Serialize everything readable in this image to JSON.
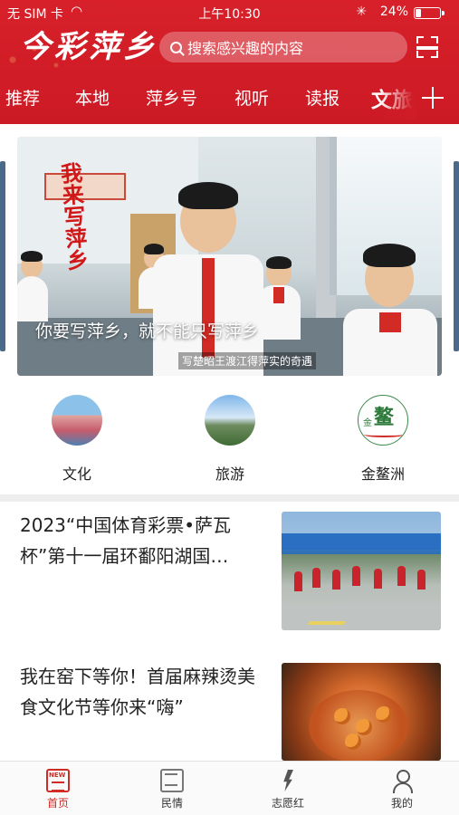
{
  "status_bar": {
    "carrier": "无 SIM 卡",
    "time": "上午10:30",
    "battery": "24%",
    "battery_level": 0.24
  },
  "header": {
    "logo_text": "今彩萍乡",
    "search_placeholder": "搜索感兴趣的内容"
  },
  "tabs": [
    {
      "label": "推荐"
    },
    {
      "label": "本地"
    },
    {
      "label": "萍乡号"
    },
    {
      "label": "视听"
    },
    {
      "label": "读报"
    },
    {
      "label": "文旅",
      "active": true
    }
  ],
  "banner": {
    "vertical_text": "我来写萍乡",
    "caption": "你要写萍乡，就不能只写萍乡",
    "subtitle": "写楚昭王渡江得萍实的奇遇"
  },
  "quick_links": [
    {
      "label": "文化",
      "icon": "culture-icon"
    },
    {
      "label": "旅游",
      "icon": "travel-icon"
    },
    {
      "label": "金鳌洲",
      "icon": "jinaozhou-icon",
      "logo_main": "鳌",
      "logo_side": "金"
    }
  ],
  "news": [
    {
      "title": "2023“中国体育彩票•萨瓦杯”第十一届环鄱阳湖国…",
      "image": "cycling-race-image"
    },
    {
      "title": "我在窑下等你！首届麻辣烫美食文化节等你来“嗨”",
      "image": "spicy-food-image"
    }
  ],
  "bottom_nav": [
    {
      "label": "首页",
      "icon": "news-home-icon",
      "active": true
    },
    {
      "label": "民情",
      "icon": "mail-icon"
    },
    {
      "label": "志愿红",
      "icon": "volunteer-icon"
    },
    {
      "label": "我的",
      "icon": "user-icon"
    }
  ],
  "colors": {
    "brand_red": "#d7202a",
    "active_tab_red": "#d22a24"
  }
}
